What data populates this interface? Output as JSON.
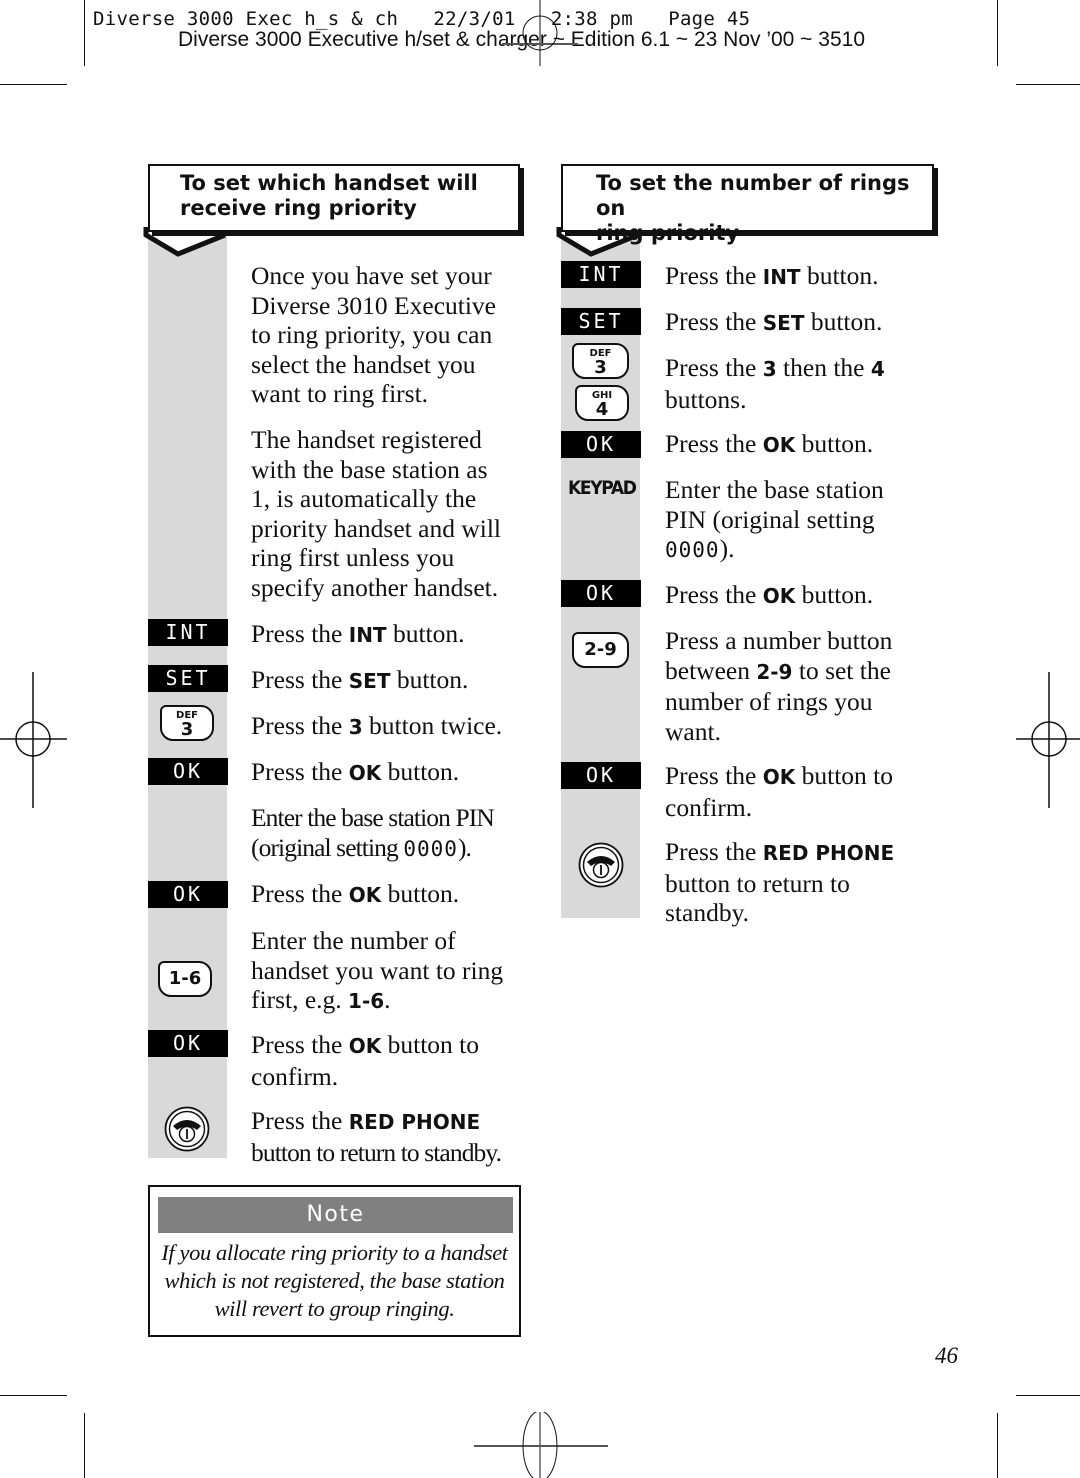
{
  "header": {
    "slug": "Diverse 3000 Exec h_s & ch   22/3/01   2:38 pm   Page 45",
    "edition": "Diverse 3000 Executive h/set & charger ~ Edition 6.1 ~ 23 Nov ’00 ~ 3510"
  },
  "left_section": {
    "title_line1": "To set which handset will",
    "title_line2": "receive ring priority",
    "intro1": [
      "Once you have set your",
      "Diverse 3010 Executive",
      "to ring priority, you can",
      "select the handset you",
      "want to ring first."
    ],
    "intro2": [
      "The handset registered",
      "with the base station as",
      "1, is automatically the",
      "priority handset and will",
      "ring first unless you",
      "specify another handset."
    ],
    "steps": [
      {
        "key": "INT",
        "pre": "Press the ",
        "bold": "INT",
        "post": " button."
      },
      {
        "key": "SET",
        "pre": "Press the ",
        "bold": "SET",
        "post": " button."
      },
      {
        "key_sub": "DEF",
        "key_num": "3",
        "pre": "Press the ",
        "bold": "3",
        "post": " button twice."
      },
      {
        "key": "OK",
        "pre": "Press the ",
        "bold": "OK",
        "post": " button."
      },
      {
        "line1": "Enter the base station PIN",
        "line2_pre": "(original setting ",
        "pin": "0000",
        "line2_post": ")."
      },
      {
        "key": "OK",
        "pre": "Press the ",
        "bold": "OK",
        "post": " button."
      },
      {
        "key": "1-6",
        "line1": "Enter the number of",
        "line2": "handset you want to ring",
        "line3_pre": "first, e.g. ",
        "bold": "1-6",
        "line3_post": "."
      },
      {
        "key": "OK",
        "pre": "Press the ",
        "bold": "OK",
        "post": " button to",
        "line2": "confirm."
      },
      {
        "icon": "red-phone",
        "pre": "Press the ",
        "bold": "RED PHONE",
        "line2": "button to return to standby."
      }
    ]
  },
  "right_section": {
    "title_line1": "To set the number of rings on",
    "title_line2": "ring priority",
    "steps": [
      {
        "key": "INT",
        "pre": "Press the ",
        "bold": "INT",
        "post": " button."
      },
      {
        "key": "SET",
        "pre": "Press the ",
        "bold": "SET",
        "post": " button."
      },
      {
        "key1_sub": "DEF",
        "key1_num": "3",
        "key2_sub": "GHI",
        "key2_num": "4",
        "pre": "Press the ",
        "bold1": "3",
        "mid": " then the ",
        "bold2": "4",
        "line2": "buttons."
      },
      {
        "key": "OK",
        "pre": "Press the ",
        "bold": "OK",
        "post": " button."
      },
      {
        "key": "KEYPAD",
        "line1": "Enter the base station",
        "line2": "PIN (original setting",
        "pin": "0000",
        "line3_post": ")."
      },
      {
        "key": "OK",
        "pre": "Press the ",
        "bold": "OK",
        "post": " button."
      },
      {
        "key": "2-9",
        "line1": "Press a number button",
        "line2_pre": "between ",
        "bold": "2-9",
        "line2_post": " to set the",
        "line3": "number of rings you",
        "line4": "want."
      },
      {
        "key": "OK",
        "pre": "Press the ",
        "bold": "OK",
        "post": " button to",
        "line2": "confirm."
      },
      {
        "icon": "red-phone",
        "pre": "Press the ",
        "bold": "RED PHONE",
        "line2": "button to return to",
        "line3": "standby."
      }
    ]
  },
  "note": {
    "heading": "Note",
    "lines": [
      "If you allocate ring priority to a handset",
      "which is not registered, the base station",
      "will revert to group ringing."
    ]
  },
  "footer": {
    "page_number": "46"
  }
}
